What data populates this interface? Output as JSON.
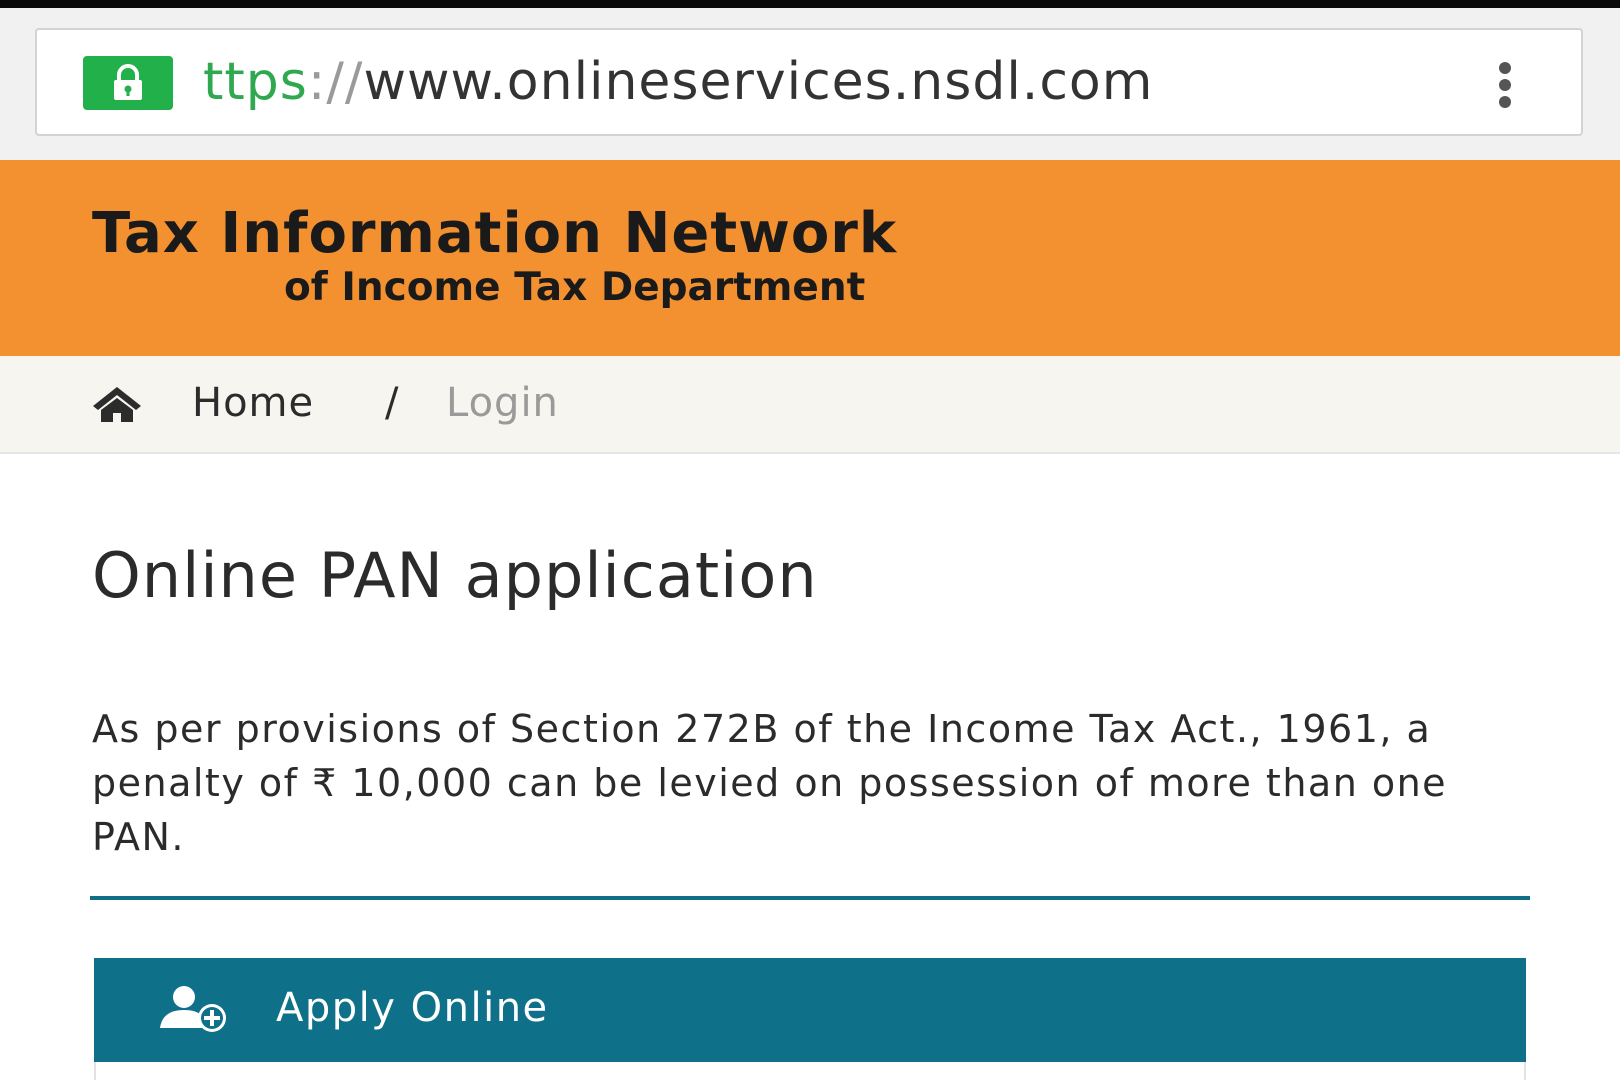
{
  "browser": {
    "url_scheme": "ttps",
    "url_separator": "://",
    "url_host": "www.onlineservices.nsdl.com",
    "secure_icon": "lock-icon",
    "menu_icon": "overflow-menu-icon"
  },
  "header": {
    "title": "Tax Information Network",
    "subtitle": "of Income Tax Department",
    "background_color": "#f39131"
  },
  "breadcrumb": {
    "home_icon": "home-icon",
    "home_label": "Home",
    "separator": "/",
    "current_label": "Login"
  },
  "main": {
    "title": "Online PAN application",
    "notice": "As per provisions of Section 272B of the Income Tax Act., 1961, a penalty of ₹ 10,000 can be levied on possession of more than one PAN.",
    "accent_color": "#0f7089",
    "apply_button": {
      "label": "Apply Online",
      "icon": "add-user-icon"
    }
  }
}
